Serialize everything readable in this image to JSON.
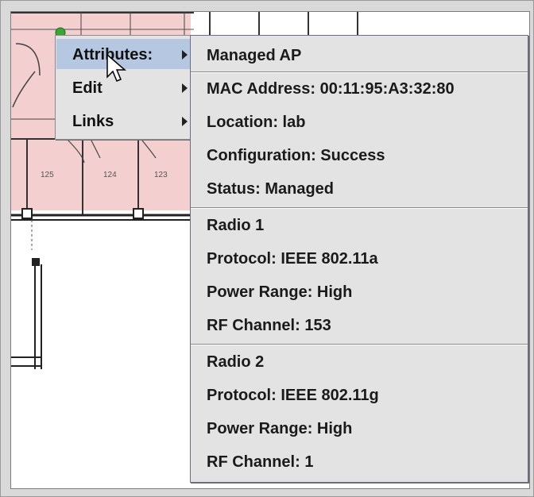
{
  "floorplan": {
    "rooms": [
      "125",
      "124",
      "123"
    ]
  },
  "context_menu": {
    "items": [
      {
        "label": "Attributes:",
        "selected": true
      },
      {
        "label": "Edit",
        "selected": false
      },
      {
        "label": "Links",
        "selected": false
      }
    ]
  },
  "attributes": {
    "general": [
      "Managed AP",
      "MAC Address: 00:11:95:A3:32:80",
      "Location: lab",
      "Configuration: Success",
      "Status: Managed"
    ],
    "radio1": [
      "Radio 1",
      "Protocol: IEEE 802.11a",
      "Power Range: High",
      "RF Channel: 153"
    ],
    "radio2": [
      "Radio 2",
      "Protocol: IEEE 802.11g",
      "Power Range: High",
      "RF Channel: 1"
    ]
  },
  "colors": {
    "highlight": "#b6c7e2",
    "room_fill": "#f3d0cf",
    "menu_bg": "#e3e3e3"
  }
}
